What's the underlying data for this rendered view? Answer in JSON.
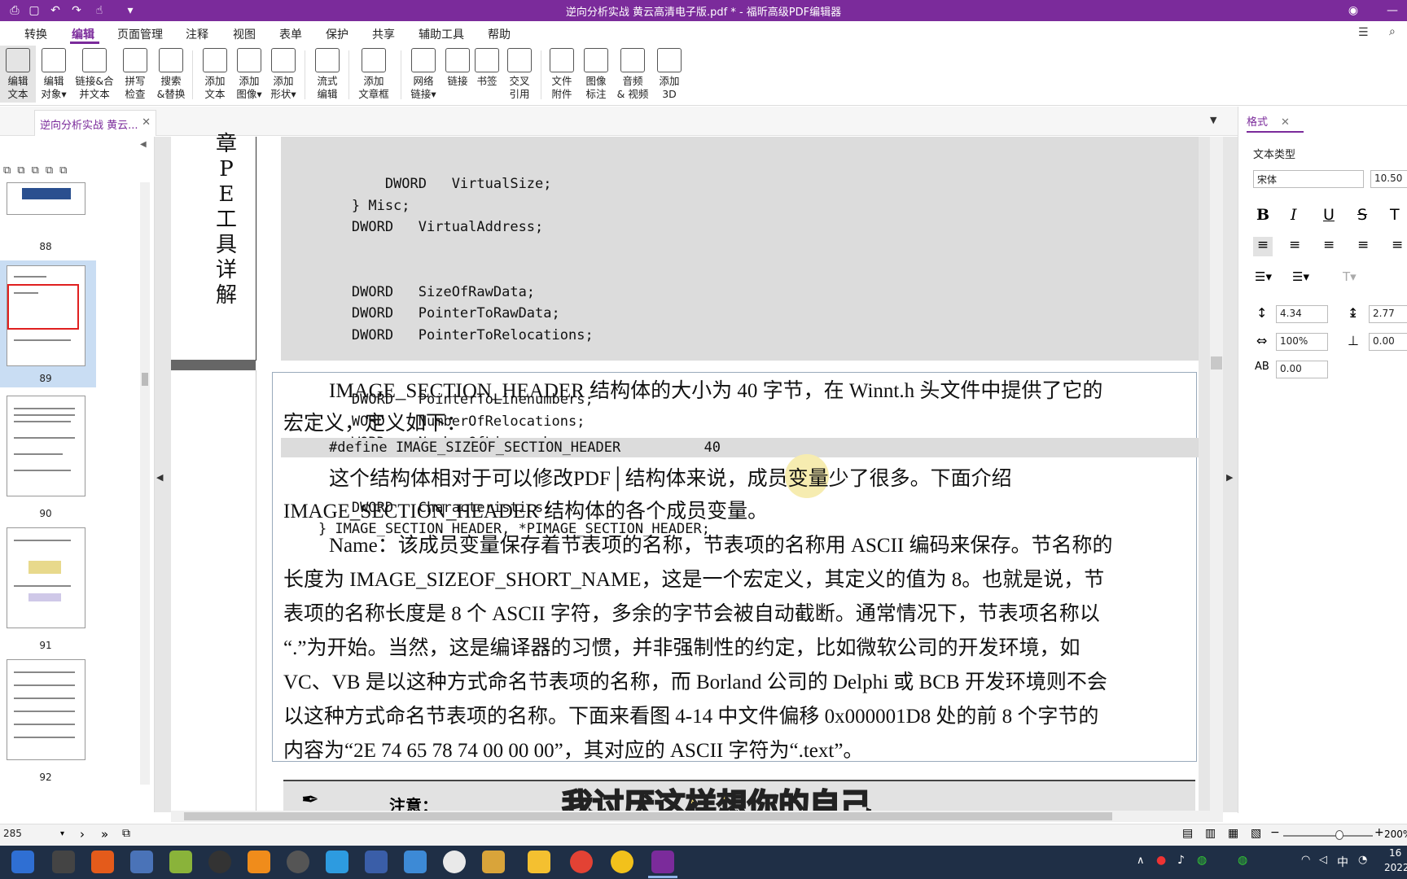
{
  "window": {
    "title": "逆向分析实战 黄云高清电子版.pdf * - 福昕高级PDF编辑器"
  },
  "menu": [
    "转换",
    "编辑",
    "页面管理",
    "注释",
    "视图",
    "表单",
    "保护",
    "共享",
    "辅助工具",
    "帮助"
  ],
  "ribbon": [
    {
      "l1": "编辑",
      "l2": "文本"
    },
    {
      "l1": "编辑",
      "l2": "对象▾"
    },
    {
      "l1": "链接&合",
      "l2": "并文本"
    },
    {
      "l1": "拼写",
      "l2": "检查"
    },
    {
      "l1": "搜索",
      "l2": "&替换"
    },
    {
      "l1": "添加",
      "l2": "文本"
    },
    {
      "l1": "添加",
      "l2": "图像▾"
    },
    {
      "l1": "添加",
      "l2": "形状▾"
    },
    {
      "l1": "流式",
      "l2": "编辑"
    },
    {
      "l1": "添加",
      "l2": "文章框"
    },
    {
      "l1": "网络",
      "l2": "链接▾"
    },
    {
      "l1": "链接",
      "l2": ""
    },
    {
      "l1": "书签",
      "l2": ""
    },
    {
      "l1": "交叉",
      "l2": "引用"
    },
    {
      "l1": "文件",
      "l2": "附件"
    },
    {
      "l1": "图像",
      "l2": "标注"
    },
    {
      "l1": "音频",
      "l2": "& 视频"
    },
    {
      "l1": "添加",
      "l2": "3D"
    }
  ],
  "tab": {
    "label": "逆向分析实战 黄云..."
  },
  "thumbs": [
    "88",
    "89",
    "90",
    "91",
    "92"
  ],
  "chapter_side": "章 PE工具详解",
  "code_lines": [
    "            DWORD   VirtualSize;",
    "        } Misc;",
    "        DWORD   VirtualAddress;",
    "        DWORD   SizeOfRawData;",
    "        DWORD   PointerToRawData;",
    "        DWORD   PointerToRelocations;",
    "        DWORD   PointerToLinenumbers;",
    "        WORD    NumberOfRelocations;",
    "        WORD    NumberOfLinenumbers;",
    "        DWORD   Characteristics;",
    "    } IMAGE_SECTION_HEADER, *PIMAGE_SECTION_HEADER;"
  ],
  "para1_l1": "IMAGE_SECTION_HEADER 结构体的大小为 40 字节，在 Winnt.h 头文件中提供了它的",
  "para1_l2": "宏定义，定义如下：",
  "define_line": "#define IMAGE_SIZEOF_SECTION_HEADER          40",
  "para2_l1": "这个结构体相对于可以修改PDF│结构体来说，成员变量少了很多。下面介绍",
  "para2_l2": "IMAGE_SECTION_HEADER 结构体的各个成员变量。",
  "para3": [
    "Name：该成员变量保存着节表项的名称，节表项的名称用 ASCII 编码来保存。节名称的",
    "长度为 IMAGE_SIZEOF_SHORT_NAME，这是一个宏定义，其定义的值为 8。也就是说，节",
    "表项的名称长度是 8 个 ASCII 字符，多余的字节会被自动截断。通常情况下，节表项名称以",
    "“.”为开始。当然，这是编译器的习惯，并非强制性的约定，比如微软公司的开发环境，如",
    "VC、VB 是以这种方式命名节表项的名称，而 Borland 公司的 Delphi 或 BCB 开发环境则不会",
    "以这种方式命名节表项的名称。下面来看图 4-14 中文件偏移 0x000001D8 处的前 8 个字节的",
    "内容为“2E 74 65 78 74 00 00 00”，其对应的 ASCII 字符为“.text”。"
  ],
  "note_label": "注意：",
  "subtitle": "我讨厌这样想你的自己",
  "panel": {
    "tab": "格式",
    "section": "文本类型",
    "font": "宋体",
    "size": "10.50",
    "line_spacing": "4.34",
    "para_spacing": "2.77",
    "scale": "100%",
    "baseline": "0.00",
    "char_spacing": "0.00",
    "indent": "0.00"
  },
  "status": {
    "page": "285",
    "zoom": "200%"
  },
  "tray": {
    "ime": "中",
    "time": "16",
    "date": "2022"
  }
}
